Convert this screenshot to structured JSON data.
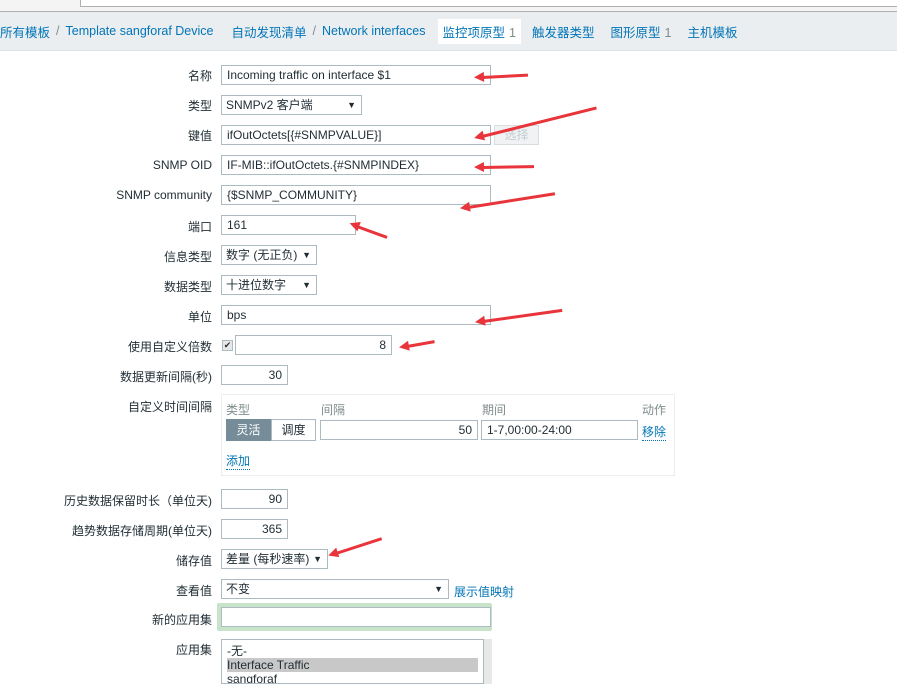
{
  "breadcrumb": {
    "all_templates": "所有模板",
    "template": "Template sangforaf Device",
    "discovery": "自动发现清单",
    "discovery_rule": "Network interfaces",
    "separator": "/"
  },
  "tabs": [
    {
      "label": "监控项原型",
      "count": "1",
      "active": true
    },
    {
      "label": "触发器类型",
      "count": "",
      "active": false
    },
    {
      "label": "图形原型",
      "count": "1",
      "active": false
    },
    {
      "label": "主机模板",
      "count": "",
      "active": false
    }
  ],
  "form": {
    "name": {
      "label": "名称",
      "value": "Incoming traffic on interface $1"
    },
    "type": {
      "label": "类型",
      "value": "SNMPv2 客户端"
    },
    "key": {
      "label": "键值",
      "value": "ifOutOctets[{#SNMPVALUE}]",
      "select_button": "选择"
    },
    "snmp_oid": {
      "label": "SNMP OID",
      "value": "IF-MIB::ifOutOctets.{#SNMPINDEX}"
    },
    "snmp_community": {
      "label": "SNMP community",
      "value": "{$SNMP_COMMUNITY}"
    },
    "port": {
      "label": "端口",
      "value": "161"
    },
    "info_type": {
      "label": "信息类型",
      "value": "数字 (无正负)"
    },
    "data_type": {
      "label": "数据类型",
      "value": "十进位数字"
    },
    "units": {
      "label": "单位",
      "value": "bps"
    },
    "multiplier": {
      "label": "使用自定义倍数",
      "checked": true,
      "value": "8"
    },
    "update_interval": {
      "label": "数据更新间隔(秒)",
      "value": "30"
    },
    "custom_intervals": {
      "label": "自定义时间间隔",
      "headers": {
        "type": "类型",
        "interval": "间隔",
        "period": "期间",
        "action": "动作"
      },
      "rows": [
        {
          "type_options": [
            "灵活",
            "调度"
          ],
          "type_selected": "灵活",
          "interval": "50",
          "period": "1-7,00:00-24:00",
          "remove": "移除"
        }
      ],
      "add": "添加"
    },
    "history": {
      "label": "历史数据保留时长（单位天)",
      "value": "90"
    },
    "trends": {
      "label": "趋势数据存储周期(单位天)",
      "value": "365"
    },
    "store_value": {
      "label": "储存值",
      "value": "差量 (每秒速率)"
    },
    "show_value": {
      "label": "查看值",
      "value": "不变",
      "link": "展示值映射"
    },
    "new_application": {
      "label": "新的应用集",
      "value": ""
    },
    "applications": {
      "label": "应用集",
      "items": [
        "-无-",
        "Interface Traffic",
        "sangforaf"
      ],
      "selected": "Interface Traffic"
    }
  },
  "colors": {
    "link": "#0275b8",
    "annotation_arrow": "#e8343a",
    "active_segment": "#768d99"
  }
}
